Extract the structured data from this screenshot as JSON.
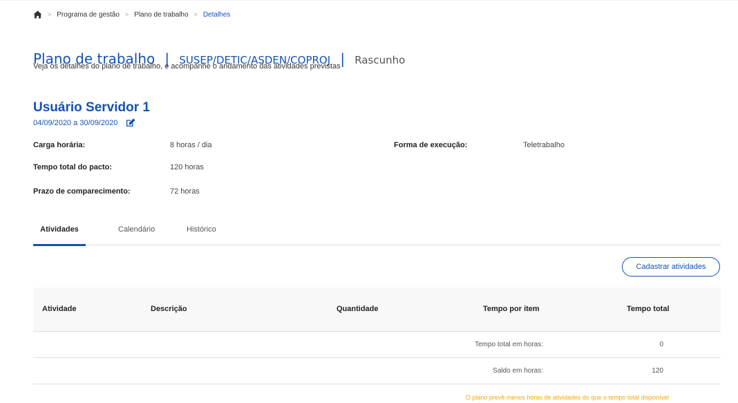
{
  "breadcrumb": {
    "home_icon": "home-icon",
    "items": [
      "Programa de gestão",
      "Plano de trabalho",
      "Detalhes"
    ],
    "separator": ">"
  },
  "header": {
    "title": "Plano de trabalho",
    "divider": "|",
    "unit": "SUSEP/DETIC/ASDEN/COPROJ",
    "status": "Rascunho",
    "subtitle": "Veja os detalhes do plano de trabalho, e acompanhe o andamento das atividades previstas"
  },
  "user": {
    "name": "Usuário Servidor 1",
    "period": "04/09/2020 a 30/09/2020",
    "edit_icon": "edit-icon"
  },
  "info": {
    "carga_label": "Carga horária:",
    "carga_value": "8 horas / dia",
    "forma_label": "Forma de execução:",
    "forma_value": "Teletrabalho",
    "tempo_label": "Tempo total do pacto:",
    "tempo_value": "120 horas",
    "prazo_label": "Prazo de comparecimento:",
    "prazo_value": "72 horas"
  },
  "tabs": [
    {
      "label": "Atividades",
      "active": true
    },
    {
      "label": "Calendário",
      "active": false
    },
    {
      "label": "Histórico",
      "active": false
    }
  ],
  "actions": {
    "cadastrar": "Cadastrar atividades"
  },
  "table": {
    "headers": [
      "Atividade",
      "Descrição",
      "Quantidade",
      "Tempo por item",
      "Tempo total"
    ],
    "rows": [],
    "summary": [
      {
        "label": "Tempo total em horas:",
        "value": "0"
      },
      {
        "label": "Saldo em horas:",
        "value": "120"
      }
    ]
  },
  "warning": "O plano prevê menos horas de atividades do que o tempo total disponível",
  "colors": {
    "primary": "#1351b4",
    "warning": "#f0a900",
    "header_bg": "#f8f8f8"
  }
}
